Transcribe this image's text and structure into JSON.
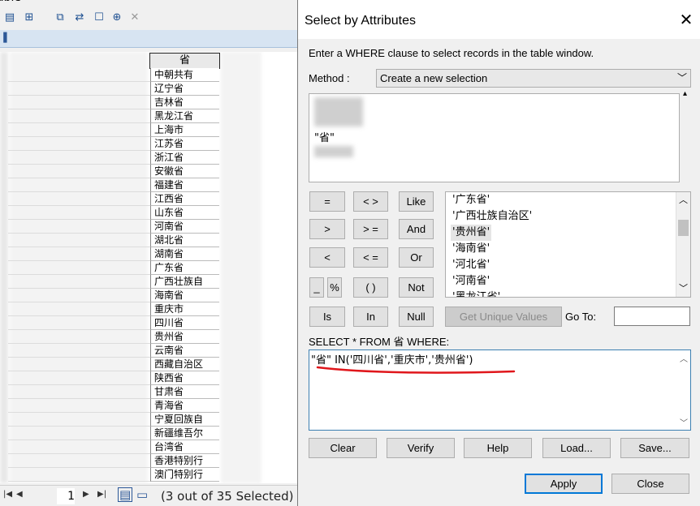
{
  "table_window": {
    "title": "able",
    "column_header": "省",
    "rows": [
      "中朝共有",
      "辽宁省",
      "吉林省",
      "黑龙江省",
      "上海市",
      "江苏省",
      "浙江省",
      "安徽省",
      "福建省",
      "江西省",
      "山东省",
      "河南省",
      "湖北省",
      "湖南省",
      "广东省",
      "广西壮族自",
      "海南省",
      "重庆市",
      "四川省",
      "贵州省",
      "云南省",
      "西藏自治区",
      "陕西省",
      "甘肃省",
      "青海省",
      "宁夏回族自",
      "新疆维吾尔",
      "台湾省",
      "香港特别行",
      "澳门特别行"
    ],
    "record_number": "1",
    "status": "(3 out of 35 Selected)"
  },
  "dialog": {
    "title": "Select by Attributes",
    "instruction": "Enter a WHERE clause to select records in the table window.",
    "method_label": "Method :",
    "method_value": "Create a new selection",
    "visible_field": "\"省\"",
    "operators": [
      "=",
      "< >",
      "Like",
      ">",
      "> =",
      "And",
      "<",
      "< =",
      "Or",
      "_",
      "%",
      "( )",
      "Not",
      "Is",
      "In",
      "Null"
    ],
    "unique_values": [
      "'广东省'",
      "'广西壮族自治区'",
      "'贵州省'",
      "'海南省'",
      "'河北省'",
      "'河南省'",
      "'黑龙江省'"
    ],
    "get_unique_values_label": "Get Unique Values",
    "goto_label": "Go To:",
    "select_prefix": "SELECT * FROM 省 WHERE:",
    "where_clause": "\"省\" IN('四川省','重庆市','贵州省')",
    "buttons": {
      "clear": "Clear",
      "verify": "Verify",
      "help": "Help",
      "load": "Load...",
      "save": "Save...",
      "apply": "Apply",
      "close": "Close"
    }
  }
}
